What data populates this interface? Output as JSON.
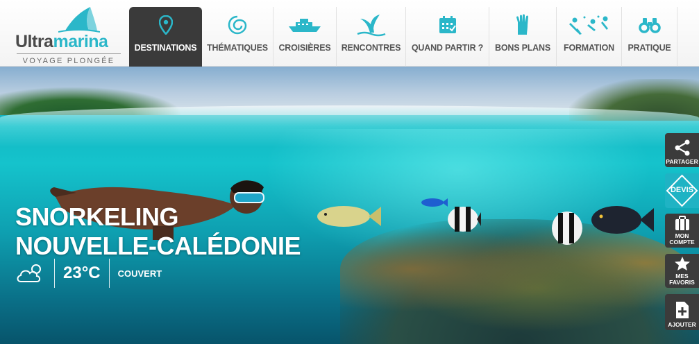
{
  "logo": {
    "word_part1": "Ultra",
    "word_part2": "marina",
    "tagline": "VOYAGE PLONGÉE"
  },
  "nav": {
    "items": [
      {
        "label": "DESTINATIONS",
        "icon": "map-pin-icon",
        "active": true
      },
      {
        "label": "THÉMATIQUES",
        "icon": "seashell-icon"
      },
      {
        "label": "CROISIÈRES",
        "icon": "boat-icon"
      },
      {
        "label": "RENCONTRES",
        "icon": "whale-tail-icon"
      },
      {
        "label": "QUAND PARTIR ?",
        "icon": "calendar-icon"
      },
      {
        "label": "BONS PLANS",
        "icon": "ok-hand-icon"
      },
      {
        "label": "FORMATION",
        "icon": "divers-icon"
      },
      {
        "label": "PRATIQUE",
        "icon": "binoculars-icon"
      }
    ]
  },
  "hero": {
    "title_line1": "SNORKELING",
    "title_line2": "NOUVELLE-CALÉDONIE",
    "weather": {
      "icon": "cloud-sun-icon",
      "temperature": "23°C",
      "condition": "COUVERT"
    }
  },
  "side_tools": {
    "share": {
      "label": "PARTAGER",
      "icon": "share-icon"
    },
    "devis": {
      "label": "DEVIS"
    },
    "account": {
      "label_line1": "MON",
      "label_line2": "COMPTE",
      "icon": "suitcase-icon"
    },
    "favorites": {
      "label_line1": "MES",
      "label_line2": "FAVORIS",
      "icon": "star-icon"
    },
    "add": {
      "label": "AJOUTER",
      "icon": "add-document-icon"
    }
  },
  "colors": {
    "accent": "#2bb7c9",
    "dark": "#3a3a3a",
    "text": "#555555"
  }
}
